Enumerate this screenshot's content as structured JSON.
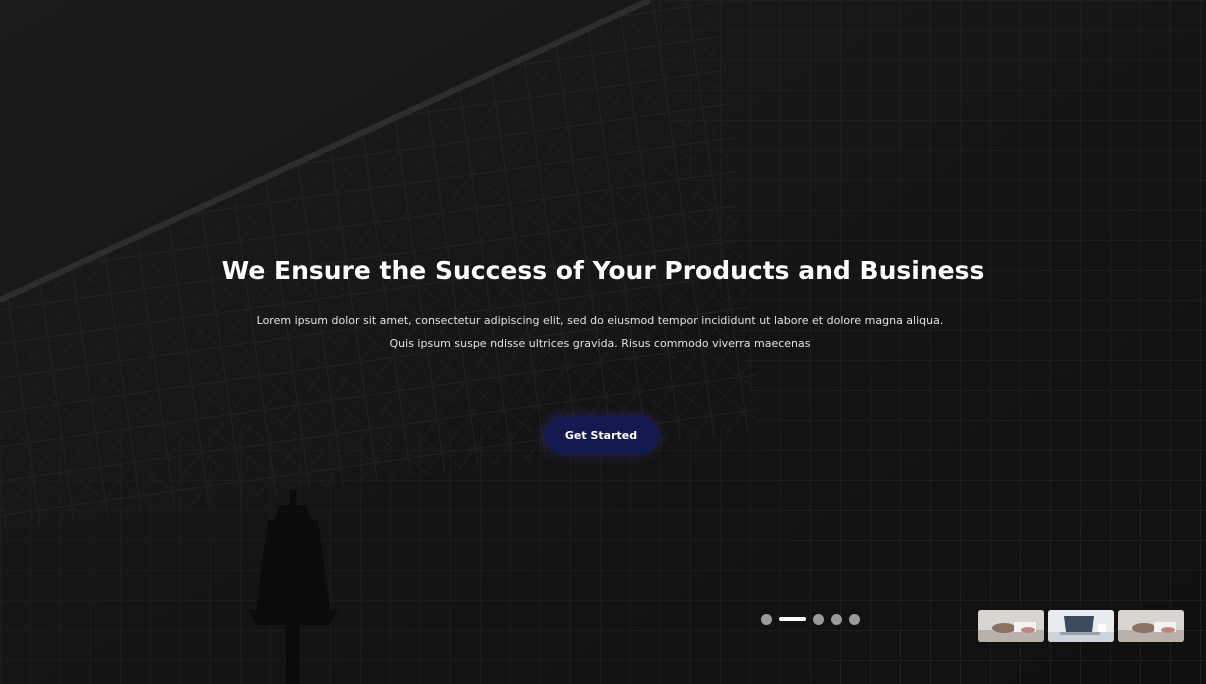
{
  "hero": {
    "title": "We Ensure the Success of Your Products and Business",
    "description": "Lorem ipsum dolor sit amet, consectetur adipiscing elit, sed do eiusmod tempor incididunt ut labore et dolore magna aliqua. Quis ipsum suspe ndisse ultrices gravida. Risus commodo viverra maecenas",
    "cta_label": "Get Started",
    "accent_color": "#141a4f"
  },
  "slider": {
    "slide_count": 5,
    "active_index": 1,
    "thumbnails": [
      {
        "icon": "workspace-hands-image"
      },
      {
        "icon": "laptop-desk-image"
      },
      {
        "icon": "workspace-hands-image"
      }
    ]
  }
}
